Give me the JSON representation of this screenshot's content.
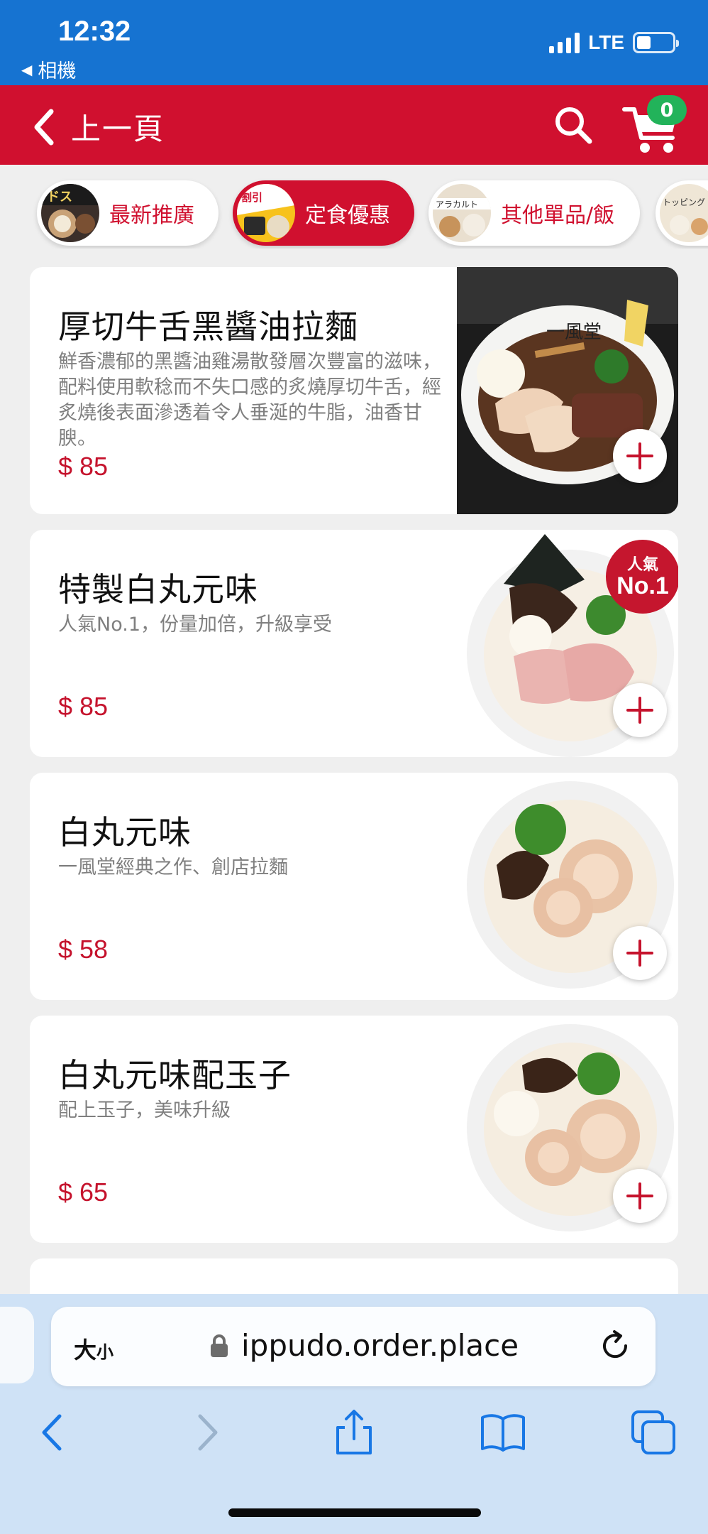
{
  "status_bar": {
    "time": "12:32",
    "back_app": "相機",
    "network": "LTE",
    "battery_level": 0.4
  },
  "header": {
    "back_label": "上一頁",
    "cart_count": "0",
    "accent_color": "#d0102f"
  },
  "categories": [
    {
      "label": "最新推廣",
      "active": false
    },
    {
      "label": "定食優惠",
      "active": true
    },
    {
      "label": "其他單品/飯",
      "active": false
    },
    {
      "label": "",
      "active": false
    }
  ],
  "menu": {
    "currency": "$",
    "items": [
      {
        "name": "厚切牛舌黑醬油拉麵",
        "description": "鮮香濃郁的黑醬油雞湯散發層次豐富的滋味，配料使用軟稔而不失口感的炙燒厚切牛舌，經炙燒後表面滲透着令人垂涎的牛脂，油香甘腴。",
        "price": "$ 85"
      },
      {
        "name": "特製白丸元味",
        "description": "人氣No.1，份量加倍，升級享受",
        "price": "$ 85",
        "badge_line1": "人氣",
        "badge_line2": "No.1"
      },
      {
        "name": "白丸元味",
        "description": "一風堂經典之作、創店拉麵",
        "price": "$ 58"
      },
      {
        "name": "白丸元味配玉子",
        "description": "配上玉子，美味升級",
        "price": "$ 65"
      }
    ]
  },
  "browser": {
    "text_size_label": "大",
    "text_size_small": "小",
    "url": "ippudo.order.place"
  }
}
